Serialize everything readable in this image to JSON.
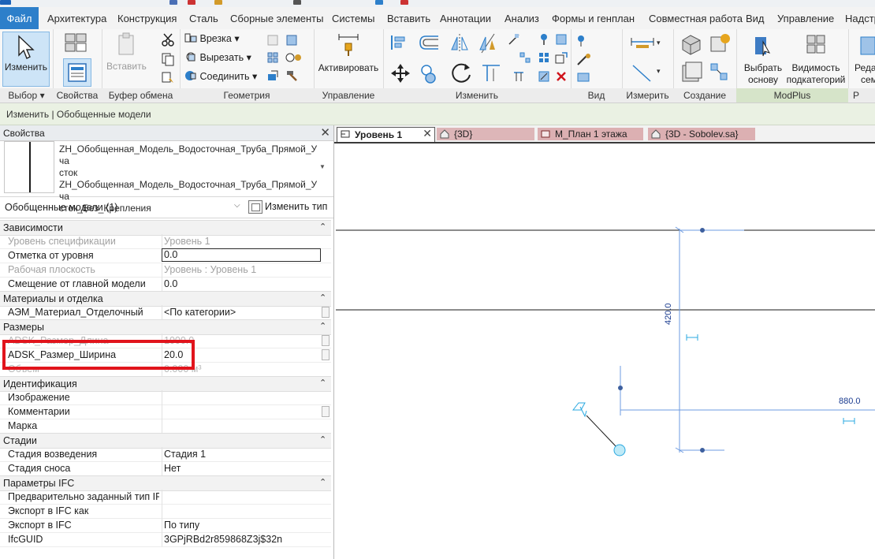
{
  "ribbon_tabs": [
    "Файл",
    "Архитектура",
    "Конструкция",
    "Сталь",
    "Сборные элементы",
    "Системы",
    "Вставить",
    "Аннотации",
    "Анализ",
    "Формы и генплан",
    "Совместная работа",
    "Вид",
    "Управление",
    "Надстр"
  ],
  "ribbon": {
    "select": {
      "modify_label": "Изменить",
      "group_label": "Выбор",
      "dropdown": "▾"
    },
    "properties": {
      "group_label": "Свойства"
    },
    "clipboard": {
      "paste_label": "Вставить",
      "group_label": "Буфер обмена"
    },
    "geometry": {
      "cope_label": "Врезка",
      "cut_label": "Вырезать",
      "join_label": "Соединить",
      "group_label": "Геометрия"
    },
    "control": {
      "activate_label": "Активировать",
      "group_label": "Управление"
    },
    "modify": {
      "group_label": "Изменить"
    },
    "view": {
      "group_label": "Вид"
    },
    "measure": {
      "group_label": "Измерить"
    },
    "create": {
      "group_label": "Создание"
    },
    "modplus": {
      "select_host_line1": "Выбрать",
      "select_host_line2": "основу",
      "subcat_line1": "Видимость",
      "subcat_line2": "подкатегорий",
      "group_label": "ModPlus"
    },
    "edit_family": {
      "line1": "Реда",
      "line2": "сем",
      "group_label": "Р"
    }
  },
  "context_bar": "Изменить | Обобщенные модели",
  "properties": {
    "title": "Свойства",
    "close": "✕",
    "type_name_line1": "ZH_Обобщенная_Модель_Водосточная_Труба_Прямой_Уча",
    "type_name_line2": "сток",
    "type_name_line3": "ZH_Обобщенная_Модель_Водосточная_Труба_Прямой_Уча",
    "type_name_line4": "сток_Без_Крепления",
    "instance_selector": "Обобщенные модели (1)",
    "edit_type": "Изменить тип",
    "groups": {
      "constraints": "Зависимости",
      "materials": "Материалы и отделка",
      "dimensions": "Размеры",
      "identity": "Идентификация",
      "phasing": "Стадии",
      "ifc": "Параметры IFC"
    },
    "rows": {
      "schedule_level": {
        "k": "Уровень спецификации",
        "v": "Уровень 1"
      },
      "elevation": {
        "k": "Отметка от уровня",
        "v": "0.0"
      },
      "work_plane": {
        "k": "Рабочая плоскость",
        "v": "Уровень : Уровень 1"
      },
      "host_offset": {
        "k": "Смещение от главной модели",
        "v": "0.0"
      },
      "material": {
        "k": "АЭМ_Материал_Отделочный",
        "v": "<По категории>"
      },
      "length": {
        "k": "ADSK_Размер_Длина",
        "v": "1000.0"
      },
      "width": {
        "k": "ADSK_Размер_Ширина",
        "v": "20.0"
      },
      "volume": {
        "k": "Объем",
        "v": "0.000 м³"
      },
      "image": {
        "k": "Изображение",
        "v": ""
      },
      "comments": {
        "k": "Комментарии",
        "v": ""
      },
      "mark": {
        "k": "Марка",
        "v": ""
      },
      "phase_created": {
        "k": "Стадия возведения",
        "v": "Стадия 1"
      },
      "phase_demolished": {
        "k": "Стадия сноса",
        "v": "Нет"
      },
      "ifc_predefined": {
        "k": "Предварительно заданный тип IFC",
        "v": ""
      },
      "ifc_export_as": {
        "k": "Экспорт в IFC как",
        "v": ""
      },
      "ifc_export": {
        "k": "Экспорт в IFC",
        "v": "По типу"
      },
      "ifc_guid": {
        "k": "IfcGUID",
        "v": "3GPjRBd2r859868Z3j$32n"
      }
    }
  },
  "view_tabs": [
    {
      "label": "Уровень 1",
      "active": true
    },
    {
      "label": "{3D}",
      "active": false
    },
    {
      "label": "М_План 1 этажа",
      "active": false
    },
    {
      "label": "{3D - Sobolev.sa}",
      "active": false
    }
  ],
  "canvas": {
    "dim_vertical": "420.0",
    "dim_horizontal": "880.0",
    "line_color": "#1a1a1a",
    "selection_color": "#6d9be0",
    "dim_color": "#1a3b8f"
  },
  "colors": {
    "accent": "#2d7fca",
    "highlight_box": "#e1141c",
    "context_bar": "#eaf1e3"
  }
}
